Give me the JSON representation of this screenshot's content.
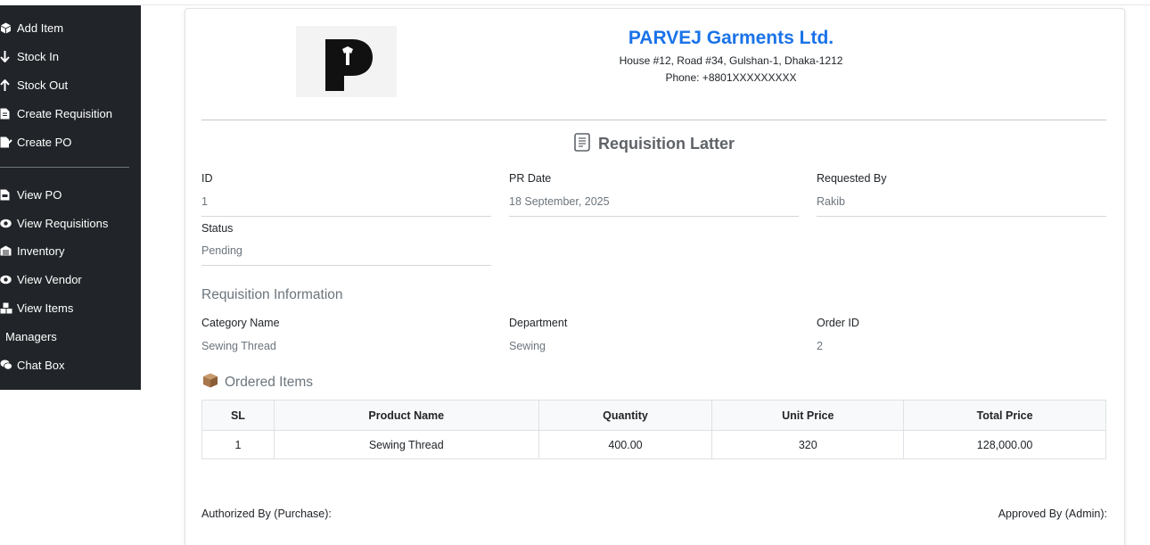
{
  "sidebar": {
    "items": [
      {
        "label": "Add Item",
        "icon": "box-icon"
      },
      {
        "label": "Stock In",
        "icon": "arrow-down-icon"
      },
      {
        "label": "Stock Out",
        "icon": "arrow-up-icon"
      },
      {
        "label": "Create Requisition",
        "icon": "file-icon"
      },
      {
        "label": "Create PO",
        "icon": "file-signature-icon"
      },
      {
        "label": "View PO",
        "icon": "file-invoice-icon"
      },
      {
        "label": "View Requisitions",
        "icon": "eye-icon"
      },
      {
        "label": "Inventory",
        "icon": "warehouse-icon"
      },
      {
        "label": "View Vendor",
        "icon": "eye-icon"
      },
      {
        "label": "View Items",
        "icon": "boxes-icon"
      },
      {
        "label": "Managers",
        "icon": ""
      },
      {
        "label": "Chat Box",
        "icon": "comments-icon"
      }
    ]
  },
  "company": {
    "name": "PARVEJ Garments Ltd.",
    "address": "House #12, Road #34, Gulshan-1, Dhaka-1212",
    "phone": "Phone: +8801XXXXXXXXX",
    "logo_letter": "P"
  },
  "document": {
    "title": "Requisition Latter"
  },
  "fields": {
    "id_label": "ID",
    "id_value": "1",
    "pr_date_label": "PR Date",
    "pr_date_value": "18 September, 2025",
    "requested_by_label": "Requested By",
    "requested_by_value": "Rakib",
    "status_label": "Status",
    "status_value": "Pending"
  },
  "requisition_info": {
    "title": "Requisition Information",
    "category_label": "Category Name",
    "category_value": "Sewing Thread",
    "department_label": "Department",
    "department_value": "Sewing",
    "order_id_label": "Order ID",
    "order_id_value": "2"
  },
  "ordered_items": {
    "title": "Ordered Items",
    "columns": [
      "SL",
      "Product Name",
      "Quantity",
      "Unit Price",
      "Total Price"
    ],
    "rows": [
      [
        "1",
        "Sewing Thread",
        "400.00",
        "320",
        "128,000.00"
      ]
    ]
  },
  "signatures": {
    "authorized": "Authorized By (Purchase):",
    "approved": "Approved By (Admin):"
  },
  "colors": {
    "sidebar_bg": "#212529",
    "brand": "#1a73e8",
    "muted": "#6c757d"
  }
}
